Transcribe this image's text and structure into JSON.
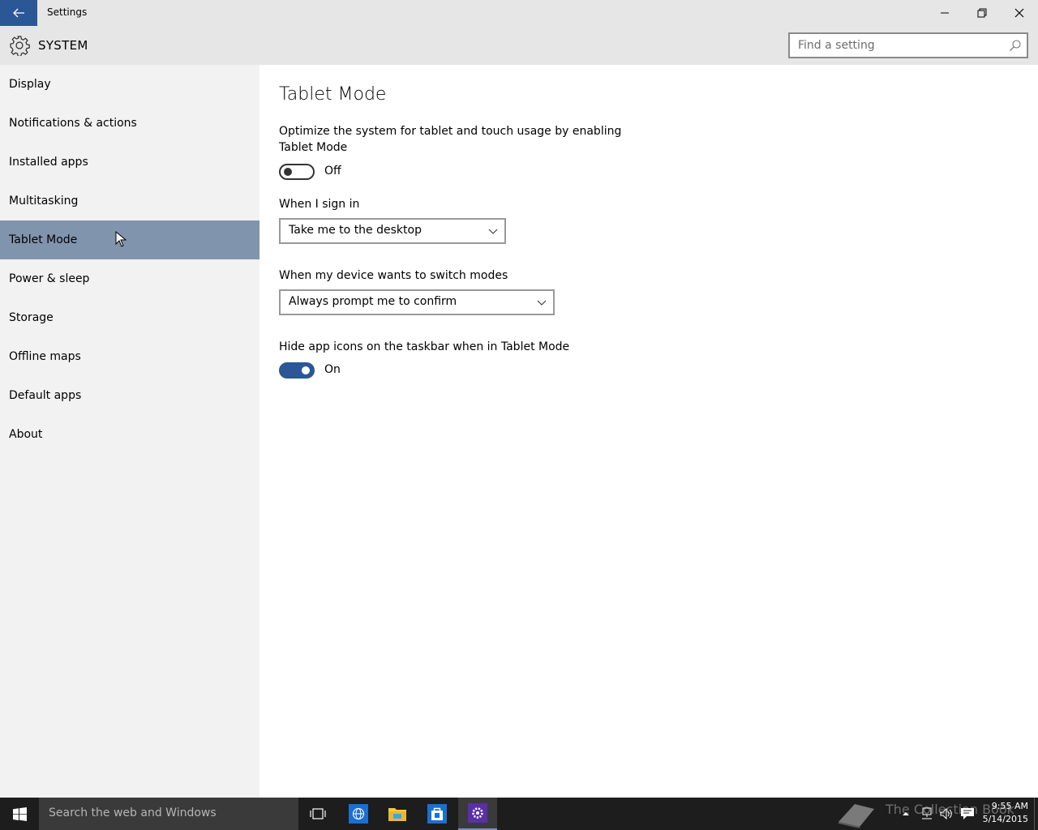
{
  "window": {
    "title": "Settings",
    "accent": "#2b5797"
  },
  "header": {
    "section": "SYSTEM",
    "search_placeholder": "Find a setting"
  },
  "sidebar": {
    "selected_color": "#8194ae",
    "items": [
      {
        "label": "Display"
      },
      {
        "label": "Notifications & actions"
      },
      {
        "label": "Installed apps"
      },
      {
        "label": "Multitasking"
      },
      {
        "label": "Tablet Mode",
        "selected": true
      },
      {
        "label": "Power & sleep"
      },
      {
        "label": "Storage"
      },
      {
        "label": "Offline maps"
      },
      {
        "label": "Default apps"
      },
      {
        "label": "About"
      }
    ]
  },
  "content": {
    "title": "Tablet Mode",
    "tablet_mode": {
      "description": "Optimize the system for tablet and touch usage by enabling Tablet Mode",
      "state": "Off"
    },
    "sign_in": {
      "label": "When I sign in",
      "selected": "Take me to the desktop"
    },
    "switch_modes": {
      "label": "When my device wants to switch modes",
      "selected": "Always prompt me to confirm"
    },
    "hide_icons": {
      "label": "Hide app icons on the taskbar when in Tablet Mode",
      "state": "On"
    }
  },
  "taskbar": {
    "search_placeholder": "Search the web and Windows",
    "watermark": "The Collection Book",
    "time": "9:55 AM",
    "date": "5/14/2015"
  }
}
